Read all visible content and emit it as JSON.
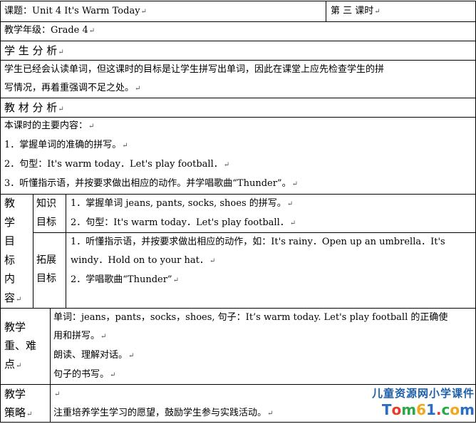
{
  "return_mark": "↵",
  "header": {
    "course_title": "课题：Unit 4 It's Warm Today",
    "lesson_period": "第 三 课时",
    "grade": "教学年级：Grade 4"
  },
  "student_analysis": {
    "heading": "学 生 分 析",
    "text_line1": "学生已经会认读单词，但这课时的目标是让学生拼写出单词，因此在课堂上应先检查学生的拼",
    "text_line2": "写情况，再着重强调不足之处。"
  },
  "material_analysis": {
    "heading": "教 材 分 析",
    "intro": "本课时的主要内容：",
    "items": [
      "1．掌握单词的准确的拼写。",
      "2．句型：It's warm today．Let's play football．",
      "3．听懂指示语，并按要求做出相应的动作。并学唱歌曲“Thunder”。"
    ]
  },
  "objectives": {
    "label_chars": [
      "教",
      "学",
      "目",
      "标",
      "内",
      "容"
    ],
    "knowledge": {
      "label_line1": "知识",
      "label_line2": "目标",
      "items": [
        "1．掌握单词 jeans, pants, socks, shoes 的拼写。",
        "2．句型：It's warm today．Let's play football．"
      ]
    },
    "extension": {
      "label_line1": "拓展",
      "label_line2": "目标",
      "line1": "1．听懂指示语，并按要求做出相应的动作，如：It's rainy．Open up an umbrella．It's",
      "line2": "windy．Hold on to your hat．",
      "line3": "2．学唱歌曲“Thunder”"
    }
  },
  "key_points": {
    "label_line1": "教学",
    "label_line2": "重、难",
    "label_line3": "点",
    "line1": "单词：jeans，pants，socks，shoes, 句子：It’s warm today.  Let's play football 的正确使",
    "line2": "用和拼写。",
    "line3": "朗读、理解对话。",
    "line4": "句子的书写。"
  },
  "strategy": {
    "label_line1": "教学",
    "label_line2": "策略",
    "text": "注重培养学生学习的愿望，鼓励学生参与实践活动。"
  },
  "watermark": {
    "site_name": "儿童资源网小学课件",
    "logo_text": "Tom61.com",
    "logo_colors": [
      "#2b6cc4",
      "#e8392b",
      "#29a84a",
      "#f2a71b",
      "#2b6cc4",
      "#e8392b",
      "#29a84a",
      "#f2a71b",
      "#2b6cc4"
    ]
  }
}
